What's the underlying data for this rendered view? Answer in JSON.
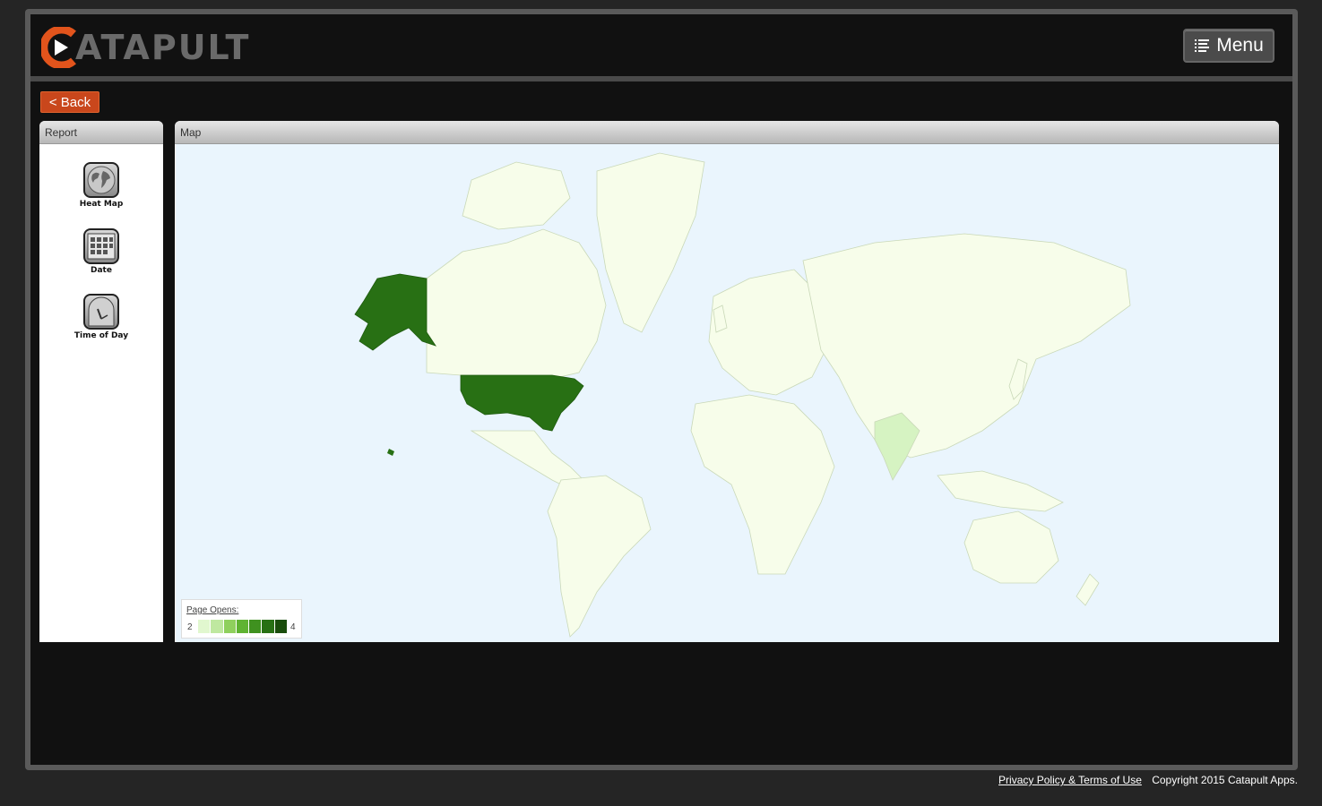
{
  "app": {
    "brand_initial": "C",
    "brand_rest": "ATAPULT",
    "accent_color": "#e2541c"
  },
  "header": {
    "menu_label": "Menu",
    "menu_icon": "list-icon"
  },
  "nav": {
    "back_label": "< Back"
  },
  "report_panel": {
    "title": "Report",
    "items": [
      {
        "label": "Heat Map",
        "icon": "globe-icon"
      },
      {
        "label": "Date",
        "icon": "calendar-icon"
      },
      {
        "label": "Time of Day",
        "icon": "clock-icon"
      }
    ]
  },
  "map_panel": {
    "title": "Map",
    "highlighted": [
      {
        "region": "United States",
        "color": "#287014"
      },
      {
        "region": "India",
        "color": "#d6f3c2"
      }
    ],
    "base_land_color": "#f7fdea",
    "ocean_color": "#eaf5fd",
    "legend": {
      "title": "Page Opens:",
      "min": "2",
      "max": "4",
      "colors": [
        "#e1f7cf",
        "#bfe8a0",
        "#8fd05d",
        "#5fb332",
        "#3f911f",
        "#287014",
        "#1a4d0c"
      ]
    }
  },
  "footer": {
    "privacy_link": "Privacy Policy & Terms of Use",
    "copyright": "Copyright 2015 Catapult Apps."
  }
}
